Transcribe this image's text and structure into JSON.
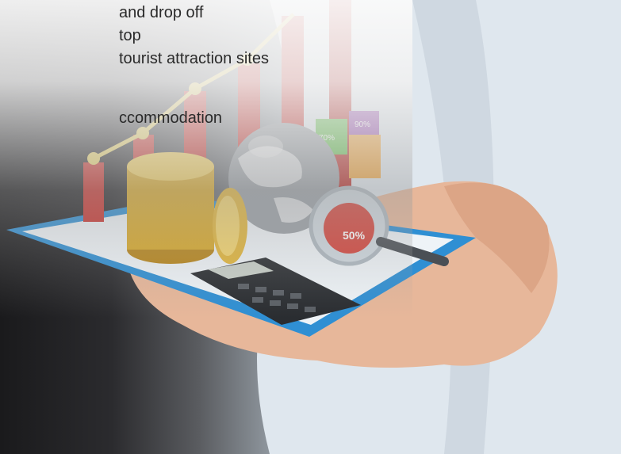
{
  "overlay_lines": [
    "and drop off",
    "top",
    "tourist attraction sites",
    "",
    "",
    "ccommodation"
  ],
  "badges": {
    "glass_badge": "50%",
    "bar_badge_1": "90%",
    "bar_badge_2": "70%"
  },
  "colors": {
    "shirt": "#dfe7ee",
    "clipboard": "#2f8fd3",
    "coins": "#d8a92a",
    "bars": "#c9342f",
    "trend_line": "#e9d36a"
  }
}
